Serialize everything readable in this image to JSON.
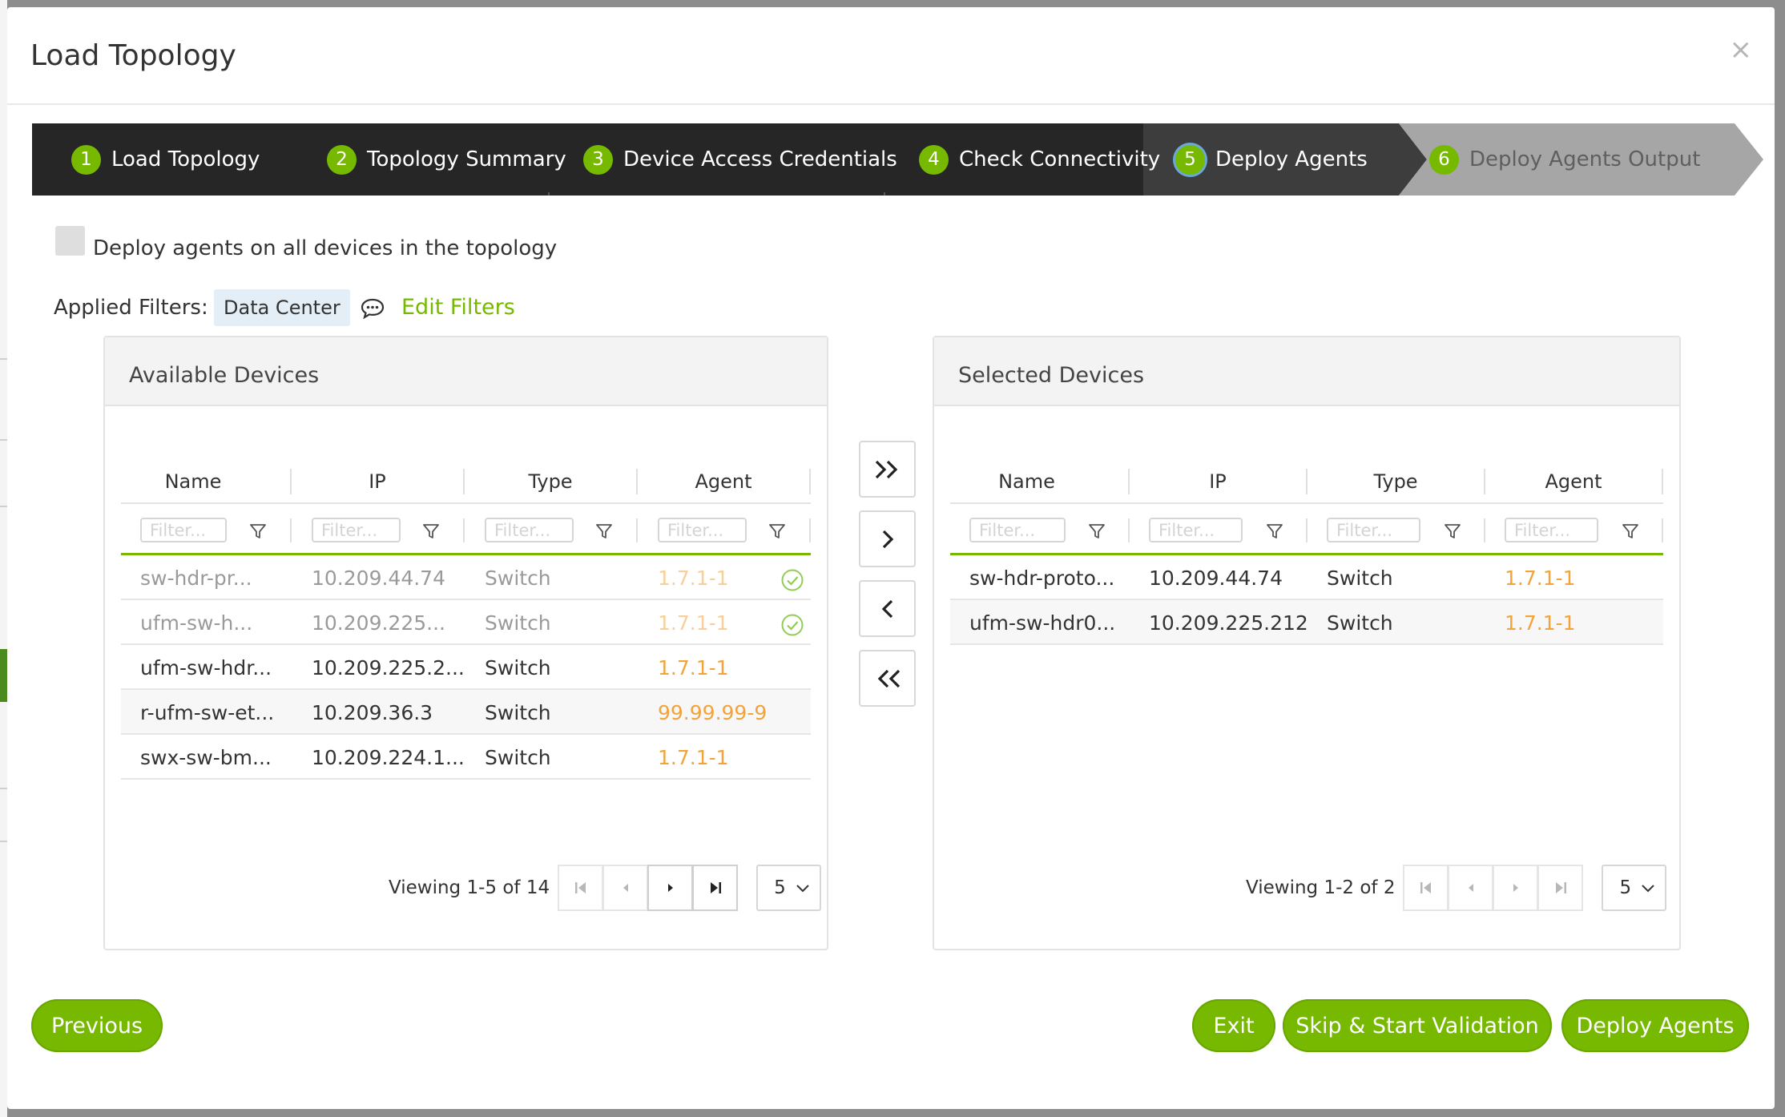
{
  "modal": {
    "title": "Load Topology",
    "close_glyph": "×"
  },
  "wizard": {
    "steps": [
      {
        "num": "1",
        "label": "Load Topology",
        "state": "done"
      },
      {
        "num": "2",
        "label": "Topology Summary",
        "state": "done"
      },
      {
        "num": "3",
        "label": "Device Access Credentials",
        "state": "done"
      },
      {
        "num": "4",
        "label": "Check Connectivity",
        "state": "done"
      },
      {
        "num": "5",
        "label": "Deploy Agents",
        "state": "active"
      },
      {
        "num": "6",
        "label": "Deploy Agents Output",
        "state": "pending"
      }
    ]
  },
  "deploy_all": {
    "label": "Deploy agents on all devices in the topology",
    "checked": false
  },
  "filters": {
    "label": "Applied Filters:",
    "chips": [
      "Data Center"
    ],
    "edit_label": "Edit Filters"
  },
  "columns": [
    "Name",
    "IP",
    "Type",
    "Agent"
  ],
  "filter_placeholder": "Filter...",
  "available": {
    "title": "Available Devices",
    "rows": [
      {
        "name": "sw-hdr-pr...",
        "ip": "10.209.44.74",
        "type": "Switch",
        "agent": "1.7.1-1",
        "selected": true
      },
      {
        "name": "ufm-sw-h...",
        "ip": "10.209.225...",
        "type": "Switch",
        "agent": "1.7.1-1",
        "selected": true
      },
      {
        "name": "ufm-sw-hdr...",
        "ip": "10.209.225.2...",
        "type": "Switch",
        "agent": "1.7.1-1",
        "selected": false
      },
      {
        "name": "r-ufm-sw-et...",
        "ip": "10.209.36.3",
        "type": "Switch",
        "agent": "99.99.99-9",
        "selected": false
      },
      {
        "name": "swx-sw-bm...",
        "ip": "10.209.224.1...",
        "type": "Switch",
        "agent": "1.7.1-1",
        "selected": false
      }
    ],
    "viewing": "Viewing 1-5 of 14",
    "page_size": "5"
  },
  "selected": {
    "title": "Selected Devices",
    "rows": [
      {
        "name": "sw-hdr-proto...",
        "ip": "10.209.44.74",
        "type": "Switch",
        "agent": "1.7.1-1"
      },
      {
        "name": "ufm-sw-hdr0...",
        "ip": "10.209.225.212",
        "type": "Switch",
        "agent": "1.7.1-1"
      }
    ],
    "viewing": "Viewing 1-2 of 2",
    "page_size": "5"
  },
  "buttons": {
    "previous": "Previous",
    "exit": "Exit",
    "skip": "Skip & Start Validation",
    "deploy": "Deploy Agents"
  },
  "colors": {
    "accent": "#76b900",
    "agent_version": "#f2a33a",
    "wizard_dark": "#262626",
    "wizard_mid": "#3d3d3d",
    "wizard_pending": "#a6a6a6"
  }
}
